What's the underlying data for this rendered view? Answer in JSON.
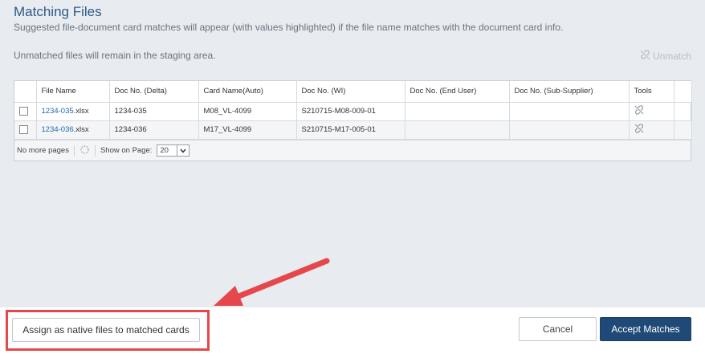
{
  "header": {
    "title": "Matching Files",
    "subtitle": "Suggested file-document card matches will appear (with values highlighted) if the file name matches with the document card info.",
    "unmatched_note": "Unmatched files will remain in the staging area.",
    "unmatch_label": "Unmatch"
  },
  "grid": {
    "columns": [
      "File Name",
      "Doc No. (Delta)",
      "Card Name(Auto)",
      "Doc No. (WI)",
      "Doc No. (End User)",
      "Doc No. (Sub-Supplier)",
      "Tools"
    ],
    "rows": [
      {
        "file_link": "1234-035",
        "file_ext": ".xlsx",
        "doc_delta": "1234-035",
        "card_name": "M08_VL-4099",
        "doc_wi": "S210715-M08-009-01",
        "doc_end_user": "",
        "doc_sub_supplier": ""
      },
      {
        "file_link": "1234-036",
        "file_ext": ".xlsx",
        "doc_delta": "1234-036",
        "card_name": "M17_VL-4099",
        "doc_wi": "S210715-M17-005-01",
        "doc_end_user": "",
        "doc_sub_supplier": ""
      }
    ],
    "pager": {
      "status": "No more pages",
      "show_label": "Show on Page:",
      "page_size": "20"
    }
  },
  "footer": {
    "assign_label": "Assign as native files to matched cards",
    "cancel_label": "Cancel",
    "accept_label": "Accept Matches"
  },
  "colors": {
    "title": "#2d5a86",
    "link": "#2169a8",
    "primary_button": "#1f4a77",
    "annotation_red": "#e5474b"
  }
}
